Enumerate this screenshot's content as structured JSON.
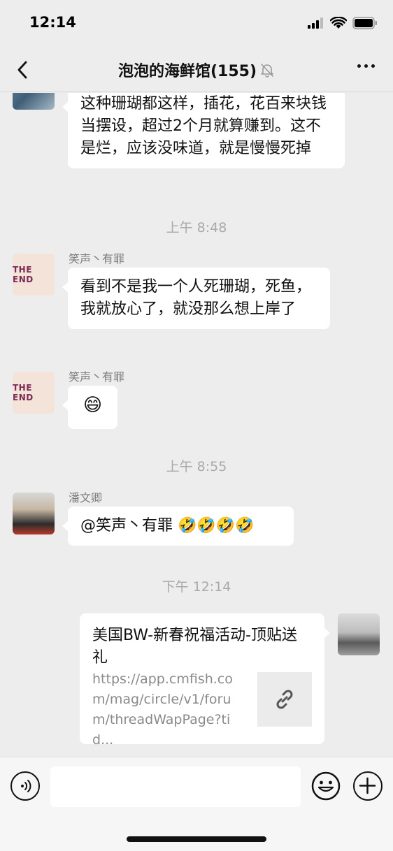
{
  "status_bar": {
    "time": "12:14"
  },
  "nav": {
    "title": "泡泡的海鲜馆(155)"
  },
  "messages": {
    "m1": {
      "text": "这种珊瑚都这样，插花，花百来块钱当摆设，超过2个月就算赚到。这不是烂，应该没味道，就是慢慢死掉"
    },
    "t1": "上午 8:48",
    "m2": {
      "sender": "笑声丶有罪",
      "text": "看到不是我一个人死珊瑚，死鱼，我就放心了，就没那么想上岸了"
    },
    "m3": {
      "sender": "笑声丶有罪",
      "text": "😄"
    },
    "t2": "上午 8:55",
    "m4": {
      "sender": "潘文卿",
      "text": "@笑声丶有罪 🤣🤣🤣🤣"
    },
    "t3": "下午 12:14",
    "link": {
      "title": "美国BW-新春祝福活动-顶贴送礼",
      "url": "https://app.cmfish.com/mag/circle/v1/forum/threadWapPage?tid..."
    }
  },
  "avatar_theend": {
    "text": "THE END"
  },
  "icons": {
    "back": "chevron-left-icon",
    "mute": "bell-slash-icon",
    "more": "more-icon",
    "voice": "voice-icon",
    "emoji": "emoji-icon",
    "plus": "plus-icon",
    "link": "link-icon"
  }
}
